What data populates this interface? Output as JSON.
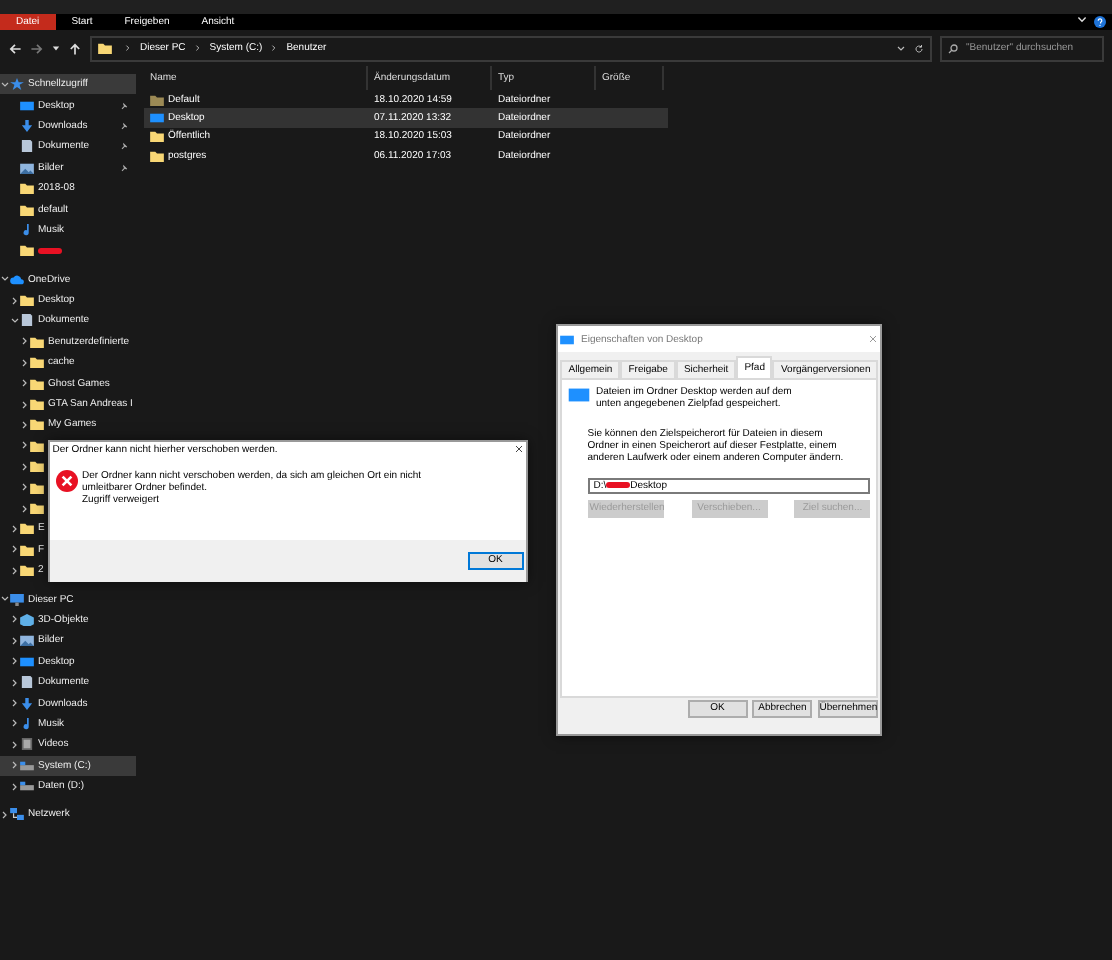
{
  "ribbon": {
    "tabs": [
      {
        "label": "Datei",
        "selected": true
      },
      {
        "label": "Start",
        "selected": false
      },
      {
        "label": "Freigeben",
        "selected": false
      },
      {
        "label": "Ansicht",
        "selected": false
      }
    ]
  },
  "address": {
    "crumbs": [
      "Dieser PC",
      "System (C:)",
      "Benutzer"
    ]
  },
  "search": {
    "placeholder": "\"Benutzer\" durchsuchen"
  },
  "sidebar": {
    "items": [
      {
        "label": "Schnellzugriff",
        "kind": "star",
        "expanded": true,
        "selected": true,
        "children": [
          {
            "label": "Desktop",
            "kind": "desktop",
            "pinned": true
          },
          {
            "label": "Downloads",
            "kind": "download",
            "pinned": true
          },
          {
            "label": "Dokumente",
            "kind": "document",
            "pinned": true
          },
          {
            "label": "Bilder",
            "kind": "picture",
            "pinned": true
          },
          {
            "label": "2018-08",
            "kind": "folder",
            "pinned": false
          },
          {
            "label": "default",
            "kind": "folder",
            "pinned": false
          },
          {
            "label": "Musik",
            "kind": "music",
            "pinned": false
          },
          {
            "kind": "folder",
            "redacted": true,
            "pinned": false
          }
        ]
      },
      {
        "label": "OneDrive",
        "kind": "cloud",
        "expanded": true,
        "selected": false,
        "children": [
          {
            "label": "Desktop",
            "kind": "folder",
            "expanded": false
          },
          {
            "label": "Dokumente",
            "kind": "document",
            "expanded": true,
            "children": [
              {
                "label": "Benutzerdefinierte",
                "kind": "folder",
                "expanded": false
              },
              {
                "label": "cache",
                "kind": "folder",
                "expanded": false
              },
              {
                "label": "Ghost Games",
                "kind": "folder",
                "expanded": false
              },
              {
                "label": "GTA San Andreas I",
                "kind": "folder",
                "expanded": false
              },
              {
                "label": "My Games",
                "kind": "folder",
                "expanded": false
              },
              {
                "kind": "folder",
                "expanded": false
              },
              {
                "kind": "folder",
                "expanded": false
              },
              {
                "kind": "folder",
                "expanded": false
              },
              {
                "kind": "folder",
                "expanded": false
              }
            ]
          },
          {
            "label": "E",
            "kind": "folder",
            "expanded": false
          },
          {
            "label": "F",
            "kind": "folder",
            "expanded": false
          },
          {
            "label": "2",
            "kind": "folder",
            "expanded": false
          }
        ]
      },
      {
        "label": "Dieser PC",
        "kind": "pc",
        "expanded": true,
        "selected": false,
        "children": [
          {
            "label": "3D-Objekte",
            "kind": "cube",
            "expanded": false
          },
          {
            "label": "Bilder",
            "kind": "picture",
            "expanded": false
          },
          {
            "label": "Desktop",
            "kind": "desktop",
            "expanded": false
          },
          {
            "label": "Dokumente",
            "kind": "document",
            "expanded": false
          },
          {
            "label": "Downloads",
            "kind": "download",
            "expanded": false
          },
          {
            "label": "Musik",
            "kind": "music",
            "expanded": false
          },
          {
            "label": "Videos",
            "kind": "video",
            "expanded": false
          },
          {
            "label": "System (C:)",
            "kind": "drive",
            "expanded": false,
            "selected": true
          },
          {
            "label": "Daten (D:)",
            "kind": "drive",
            "expanded": false,
            "selected": false
          }
        ]
      },
      {
        "label": "Netzwerk",
        "kind": "network",
        "expanded": false,
        "selected": false
      }
    ]
  },
  "files": {
    "columns": [
      "Name",
      "Änderungsdatum",
      "Typ",
      "Größe"
    ],
    "rows": [
      {
        "name": "Default",
        "kind": "hidden-folder",
        "date": "18.10.2020 14:59",
        "type": "Dateiordner",
        "selected": false
      },
      {
        "name": "Desktop",
        "kind": "desktop",
        "date": "07.11.2020 13:32",
        "type": "Dateiordner",
        "selected": true
      },
      {
        "name": "Öffentlich",
        "kind": "folder",
        "date": "18.10.2020 15:03",
        "type": "Dateiordner",
        "selected": false
      },
      {
        "name": "postgres",
        "kind": "folder",
        "date": "06.11.2020 17:03",
        "type": "Dateiordner",
        "selected": false
      }
    ]
  },
  "error_dialog": {
    "title": "Der Ordner kann nicht hierher verschoben werden.",
    "message": "Der Ordner kann nicht verschoben werden, da sich am gleichen Ort ein nicht umleitbarer Ordner befindet.",
    "detail": "Zugriff verweigert",
    "buttons": [
      "OK"
    ]
  },
  "properties_dialog": {
    "title": "Eigenschaften von Desktop",
    "tabs": [
      {
        "label": "Allgemein",
        "selected": false
      },
      {
        "label": "Freigabe",
        "selected": false
      },
      {
        "label": "Sicherheit",
        "selected": false
      },
      {
        "label": "Pfad",
        "selected": true
      },
      {
        "label": "Vorgängerversionen",
        "selected": false
      }
    ],
    "intro": "Dateien im Ordner Desktop werden auf dem unten angegebenen Zielpfad gespeichert.",
    "explanation": "Sie können den Zielspeicherort für Dateien in diesem Ordner in einen Speicherort auf dieser Festplatte, einem anderen Laufwerk oder einem anderen Computer ändern.",
    "path_prefix": "D:\\",
    "path_suffix": "Desktop",
    "actions": [
      {
        "label": "Wiederherstellen",
        "disabled": true
      },
      {
        "label": "Verschieben...",
        "disabled": true
      },
      {
        "label": "Ziel suchen...",
        "disabled": true
      }
    ],
    "buttons": [
      "OK",
      "Abbrechen",
      "Übernehmen"
    ]
  }
}
